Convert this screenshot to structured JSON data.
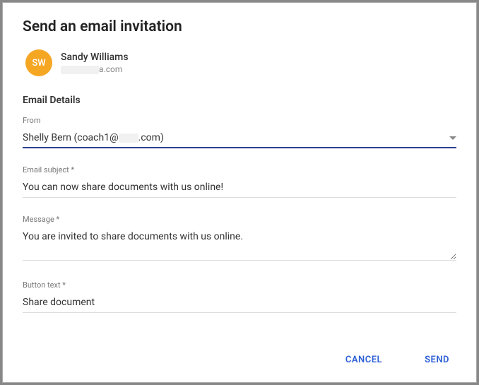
{
  "dialog": {
    "title": "Send an email invitation"
  },
  "recipient": {
    "initials": "SW",
    "name": "Sandy Williams",
    "email_suffix": "a.com"
  },
  "section": {
    "title": "Email Details"
  },
  "from": {
    "label": "From",
    "value_prefix": "Shelly Bern (coach1@",
    "value_suffix": ".com)"
  },
  "subject": {
    "label": "Email subject *",
    "value": "You can now share documents with us online!"
  },
  "message": {
    "label": "Message *",
    "value": "You are invited to share documents with us online."
  },
  "button_text": {
    "label": "Button text *",
    "value": "Share document"
  },
  "footer": {
    "cancel": "CANCEL",
    "send": "SEND"
  }
}
